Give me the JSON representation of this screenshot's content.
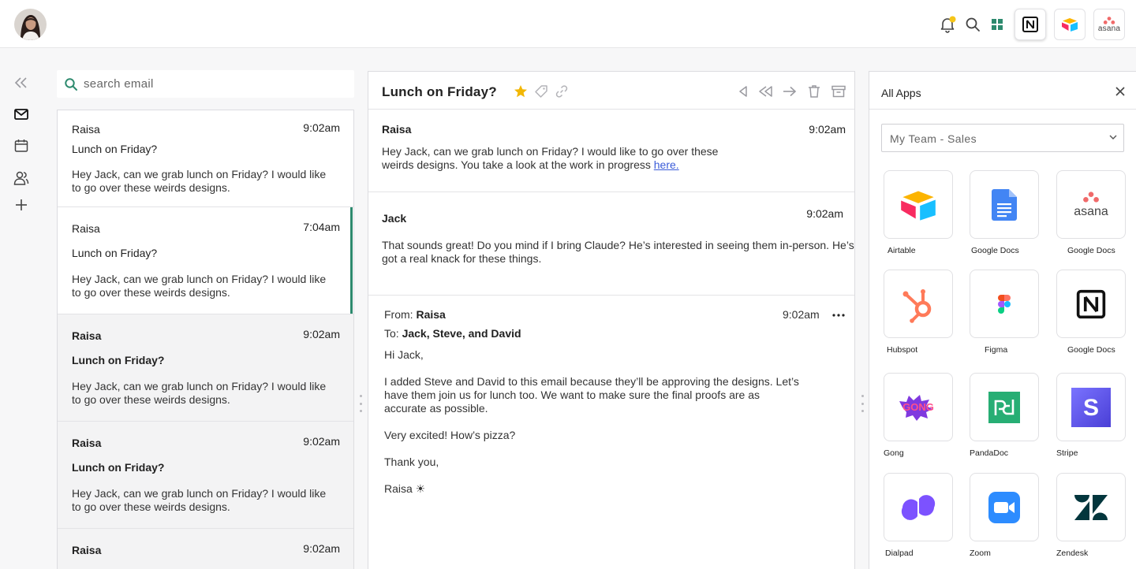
{
  "top_apps": [
    {
      "name": "Notion"
    },
    {
      "name": "Airtable"
    },
    {
      "name": "asana"
    }
  ],
  "search": {
    "placeholder": "search email"
  },
  "emails": [
    {
      "sender": "Raisa",
      "time": "9:02am",
      "subject": "Lunch on Friday?",
      "preview": "Hey Jack, can we grab lunch on Friday? I would like to go over these weirds designs."
    },
    {
      "sender": "Raisa",
      "time": "7:04am",
      "subject": "Lunch on Friday?",
      "preview": "Hey Jack, can we grab lunch on Friday? I would like to go over these weirds designs."
    },
    {
      "sender": "Raisa",
      "time": "9:02am",
      "subject": "Lunch on Friday?",
      "preview": "Hey Jack, can we grab lunch on Friday? I would like to go over these weirds designs."
    },
    {
      "sender": "Raisa",
      "time": "9:02am",
      "subject": "Lunch on Friday?",
      "preview": "Hey Jack, can we grab lunch on Friday? I would like to go over these weirds designs."
    },
    {
      "sender": "Raisa",
      "time": "9:02am"
    }
  ],
  "thread": {
    "title": "Lunch on Friday?",
    "messages": [
      {
        "from": "Raisa",
        "time": "9:02am",
        "body": "Hey Jack, can we grab lunch on Friday? I would like to go over these weirds designs. You take a look at the work in progress",
        "link": "here."
      },
      {
        "from": "Jack",
        "time": "9:02am",
        "body": "That sounds great! Do you mind if I bring Claude? He’s interested in seeing them in-person. He’s got a real knack for these things."
      }
    ],
    "full": {
      "from_label": "From:",
      "from_name": "Raisa",
      "to_label": "To:",
      "to_names": "Jack, Steve, and David",
      "time": "9:02am",
      "greeting": "Hi Jack,",
      "para1_line1": "I added Steve and David to this email because they’ll be approving the designs. Let’s",
      "para1_line2": "have them join us for lunch too. We want to make sure the final proofs are as",
      "para1_line3": "accurate as possible.",
      "para2": "Very excited! How’s pizza?",
      "closing": "Thank you,",
      "signature": "Raisa ☀"
    }
  },
  "apps_panel": {
    "title": "All Apps",
    "team": "My Team - Sales",
    "apps": [
      {
        "name": "Airtable"
      },
      {
        "name": "Google Docs"
      },
      {
        "name": "Google Docs",
        "logo_text": "asana"
      },
      {
        "name": "Hubspot"
      },
      {
        "name": "Figma"
      },
      {
        "name": "Google Docs"
      },
      {
        "name": "Gong",
        "logo_text": "GONG"
      },
      {
        "name": "PandaDoc"
      },
      {
        "name": "Stripe",
        "logo_text": "S"
      },
      {
        "name": "Dialpad"
      },
      {
        "name": "Zoom"
      },
      {
        "name": "Zendesk"
      }
    ]
  },
  "colors": {
    "accent": "#2d8a6e",
    "link": "#3a5bd8",
    "star": "#f2b705",
    "notif_badge": "#f5c518"
  }
}
